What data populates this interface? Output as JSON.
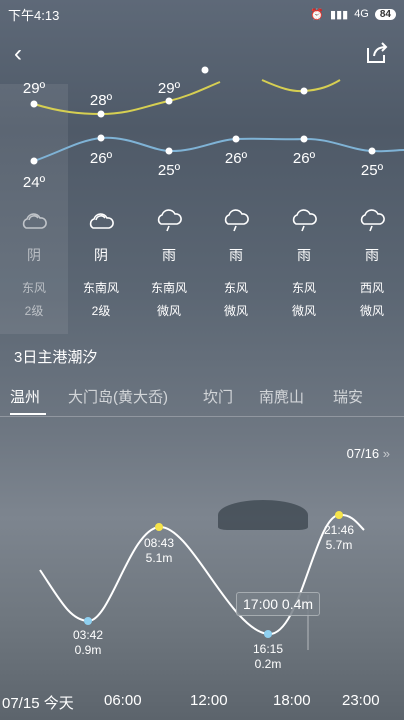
{
  "status": {
    "time": "下午4:13",
    "network": "4G",
    "battery": "84"
  },
  "high_temps": [
    "29º",
    "28º",
    "29º"
  ],
  "low_temps": [
    "24º",
    "26º",
    "25º",
    "26º",
    "26º",
    "25º"
  ],
  "days": [
    {
      "weather": "阴",
      "wind": "东风",
      "level": "2级",
      "icon": "cloudy-icon"
    },
    {
      "weather": "阴",
      "wind": "东南风",
      "level": "2级",
      "icon": "cloudy-icon"
    },
    {
      "weather": "雨",
      "wind": "东南风",
      "level": "微风",
      "icon": "rain-icon"
    },
    {
      "weather": "雨",
      "wind": "东风",
      "level": "微风",
      "icon": "rain-icon"
    },
    {
      "weather": "雨",
      "wind": "东风",
      "level": "微风",
      "icon": "rain-icon"
    },
    {
      "weather": "雨",
      "wind": "西风",
      "level": "微风",
      "icon": "rain-icon"
    }
  ],
  "tide": {
    "title": "3日主港潮汐",
    "tabs": [
      "温州",
      "大门岛(黄大岙)",
      "坎门",
      "南麂山",
      "瑞安"
    ],
    "next_date": "07/16",
    "points": [
      {
        "time": "03:42",
        "height": "0.9m"
      },
      {
        "time": "08:43",
        "height": "5.1m"
      },
      {
        "time": "16:15",
        "height": "0.2m"
      },
      {
        "time": "21:46",
        "height": "5.7m"
      }
    ],
    "tooltip": "17:00 0.4m",
    "axis": [
      "07/15 今天",
      "06:00",
      "12:00",
      "18:00",
      "23:00"
    ]
  },
  "colors": {
    "high_line": "#d6cf52",
    "low_line": "#7fb3d6",
    "high_dot": "#f5e34a",
    "low_dot": "#8fd0f0"
  }
}
